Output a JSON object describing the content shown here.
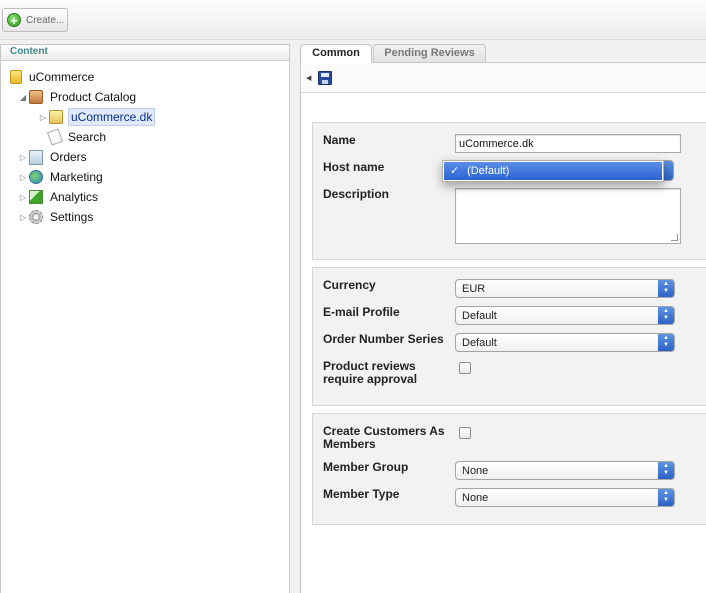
{
  "toolbar": {
    "create_label": "Create..."
  },
  "left": {
    "header": "Content",
    "tree": [
      {
        "label": "uCommerce",
        "icon": "folder-icon"
      },
      {
        "label": "Product Catalog",
        "icon": "catalog-icon"
      },
      {
        "label": "uCommerce.dk",
        "icon": "store-icon",
        "selected": true
      },
      {
        "label": "Search",
        "icon": "search-icon"
      },
      {
        "label": "Orders",
        "icon": "orders-icon"
      },
      {
        "label": "Marketing",
        "icon": "marketing-icon"
      },
      {
        "label": "Analytics",
        "icon": "analytics-icon"
      },
      {
        "label": "Settings",
        "icon": "settings-icon"
      }
    ]
  },
  "tabs": [
    {
      "label": "Common",
      "active": true
    },
    {
      "label": "Pending Reviews",
      "active": false
    }
  ],
  "form": {
    "name_label": "Name",
    "name_value": "uCommerce.dk",
    "host_label": "Host name",
    "host_option": "(Default)",
    "host_check": "✓",
    "description_label": "Description",
    "currency_label": "Currency",
    "currency_value": "EUR",
    "email_profile_label": "E-mail Profile",
    "email_profile_value": "Default",
    "order_series_label": "Order Number Series",
    "order_series_value": "Default",
    "reviews_label_line1": "Product reviews",
    "reviews_label_line2": "require approval",
    "create_customers_line1": "Create Customers As",
    "create_customers_line2": "Members",
    "member_group_label": "Member Group",
    "member_group_value": "None",
    "member_type_label": "Member Type",
    "member_type_value": "None"
  },
  "colors": {
    "accent": "#2b63d3",
    "header_text": "#3e8a8a"
  }
}
